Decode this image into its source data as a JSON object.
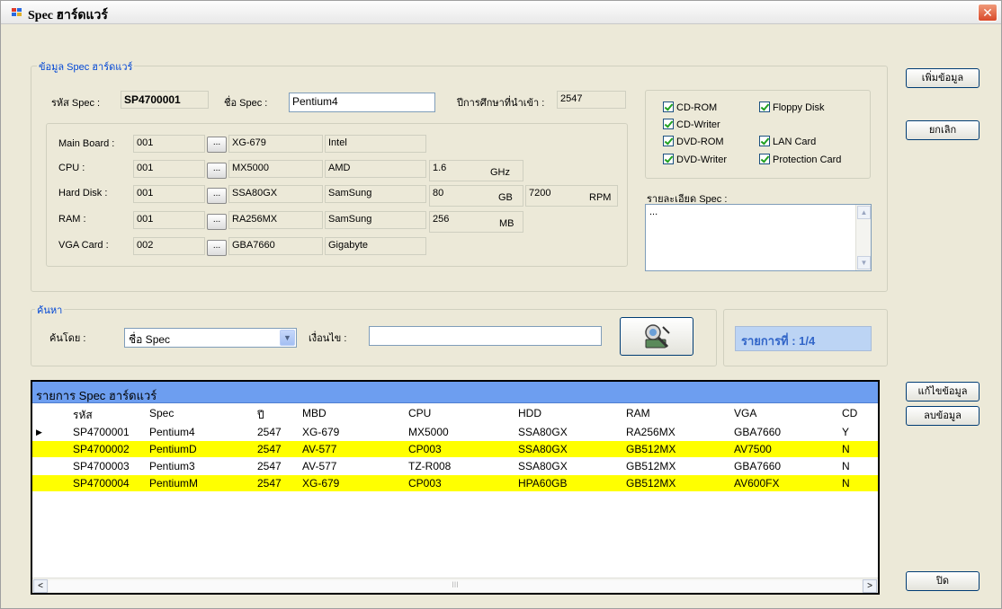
{
  "window": {
    "title": "Spec ฮาร์ดแวร์",
    "close_glyph": "✕"
  },
  "spec_group": {
    "legend": "ข้อมูล Spec ฮาร์ดแวร์",
    "spec_code_label": "รหัส Spec :",
    "spec_code": "SP4700001",
    "spec_name_label": "ชื่อ Spec :",
    "spec_name": "Pentium4",
    "year_label": "ปีการศึกษาที่นำเข้า :",
    "year": "2547",
    "browse_glyph": "...",
    "components": [
      {
        "label": "Main Board :",
        "code": "001",
        "model": "XG-679",
        "brand": "Intel",
        "size": "",
        "unit": "",
        "extra": "",
        "extra_unit": ""
      },
      {
        "label": "CPU :",
        "code": "001",
        "model": "MX5000",
        "brand": "AMD",
        "size": "1.6",
        "unit": "GHz",
        "extra": "",
        "extra_unit": ""
      },
      {
        "label": "Hard Disk :",
        "code": "001",
        "model": "SSA80GX",
        "brand": "SamSung",
        "size": "80",
        "unit": "GB",
        "extra": "7200",
        "extra_unit": "RPM"
      },
      {
        "label": "RAM :",
        "code": "001",
        "model": "RA256MX",
        "brand": "SamSung",
        "size": "256",
        "unit": "MB",
        "extra": "",
        "extra_unit": ""
      },
      {
        "label": "VGA Card :",
        "code": "002",
        "model": "GBA7660",
        "brand": "Gigabyte",
        "size": "",
        "unit": "",
        "extra": "",
        "extra_unit": ""
      }
    ],
    "checkboxes": {
      "cd_rom": "CD-ROM",
      "cd_writer": "CD-Writer",
      "dvd_rom": "DVD-ROM",
      "dvd_writer": "DVD-Writer",
      "floppy": "Floppy Disk",
      "lan": "LAN Card",
      "protection": "Protection Card"
    },
    "detail_label": "รายละเอียด Spec :",
    "detail_text": "..."
  },
  "buttons": {
    "add": "เพิ่มข้อมูล",
    "cancel": "ยกเลิก",
    "edit": "แก้ไขข้อมูล",
    "delete": "ลบข้อมูล",
    "close": "ปิด"
  },
  "search": {
    "legend": "ค้นหา",
    "by_label": "ค้นโดย :",
    "by_value": "ชื่อ Spec",
    "condition_label": "เงื่อนไข :",
    "condition_value": "",
    "record_status": "รายการที่ : 1/4"
  },
  "grid": {
    "caption": "รายการ Spec ฮาร์ดแวร์",
    "columns": [
      "รหัส",
      "Spec",
      "ปี",
      "MBD",
      "CPU",
      "HDD",
      "RAM",
      "VGA",
      "CD"
    ],
    "rows": [
      [
        "SP4700001",
        "Pentium4",
        "2547",
        "XG-679",
        "MX5000",
        "SSA80GX",
        "RA256MX",
        "GBA7660",
        "Y"
      ],
      [
        "SP4700002",
        "PentiumD",
        "2547",
        "AV-577",
        "CP003",
        "SSA80GX",
        "GB512MX",
        "AV7500",
        "N"
      ],
      [
        "SP4700003",
        "Pentium3",
        "2547",
        "AV-577",
        "TZ-R008",
        "SSA80GX",
        "GB512MX",
        "GBA7660",
        "N"
      ],
      [
        "SP4700004",
        "PentiumM",
        "2547",
        "XG-679",
        "CP003",
        "HPA60GB",
        "GB512MX",
        "AV600FX",
        "N"
      ]
    ],
    "current_row_glyph": "▶",
    "scroll_left": "<",
    "scroll_right": ">",
    "scroll_thumb": "III"
  },
  "colors": {
    "legend": "#0046d5",
    "grid_caption": "#6d9ef0",
    "row_highlight": "#ffff00",
    "status_text": "#3165c8"
  }
}
